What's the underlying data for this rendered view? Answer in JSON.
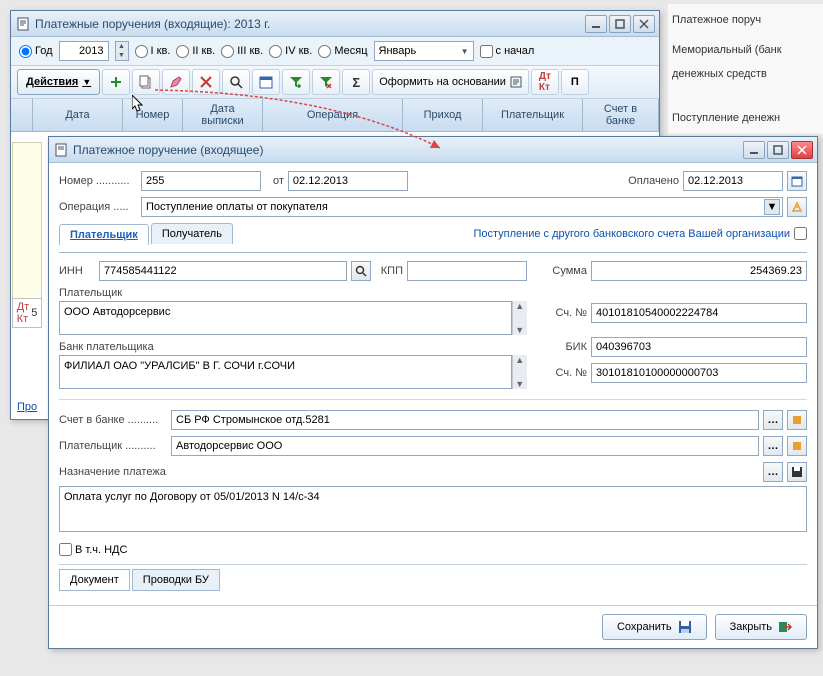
{
  "side_panel": {
    "line1": "Платежное поруч",
    "line2": "Мемориальный (банк",
    "line3": "денежных средств",
    "line4": "Поступление денежн"
  },
  "parent_window": {
    "title": "Платежные поручения (входящие): 2013 г.",
    "filter": {
      "year_label": "Год",
      "year_value": "2013",
      "q1": "I кв.",
      "q2": "II кв.",
      "q3": "III кв.",
      "q4": "IV кв.",
      "month_label": "Месяц",
      "month_value": "Январь",
      "from_start": "с начал"
    },
    "toolbar": {
      "actions": "Действия",
      "basis": "Оформить на основании"
    },
    "columns": {
      "date": "Дата",
      "number": "Номер",
      "extract_date": "Дата выписки",
      "operation": "Операция",
      "income": "Приход",
      "payer": "Плательщик",
      "bank_account": "Счет в банке"
    },
    "bottom_left": "Про",
    "marker": "5"
  },
  "dialog": {
    "title": "Платежное поручение (входящее)",
    "number_label": "Номер",
    "number_value": "255",
    "from_label": "от",
    "from_date": "02.12.2013",
    "paid_label": "Оплачено",
    "paid_date": "02.12.2013",
    "operation_label": "Операция",
    "operation_value": "Поступление оплаты от покупателя",
    "tabs": {
      "payer": "Плательщик",
      "recipient": "Получатель"
    },
    "other_account_label": "Поступление с другого банковского счета Вашей организации",
    "inn_label": "ИНН",
    "inn_value": "774585441122",
    "kpp_label": "КПП",
    "kpp_value": "",
    "sum_label": "Сумма",
    "sum_value": "254369.23",
    "payer_label": "Плательщик",
    "payer_value": "ООО Автодорсервис",
    "acct_label": "Сч. №",
    "acct1_value": "40101810540002224784",
    "bank_label": "Банк плательщика",
    "bank_value": "ФИЛИАЛ ОАО \"УРАЛСИБ\" В Г. СОЧИ г.СОЧИ",
    "bik_label": "БИК",
    "bik_value": "040396703",
    "acct2_value": "30101810100000000703",
    "bank_acct_label": "Счет в банке",
    "bank_acct_value": "СБ РФ Стромынское отд.5281",
    "payer2_label": "Плательщик",
    "payer2_value": "Автодорсервис ООО",
    "purpose_label": "Назначение платежа",
    "purpose_value": "Оплата услуг по Договору от 05/01/2013 N 14/c-34",
    "vat_label": "В т.ч. НДС",
    "bottom_tabs": {
      "document": "Документ",
      "postings": "Проводки БУ"
    },
    "save": "Сохранить",
    "close": "Закрыть"
  }
}
